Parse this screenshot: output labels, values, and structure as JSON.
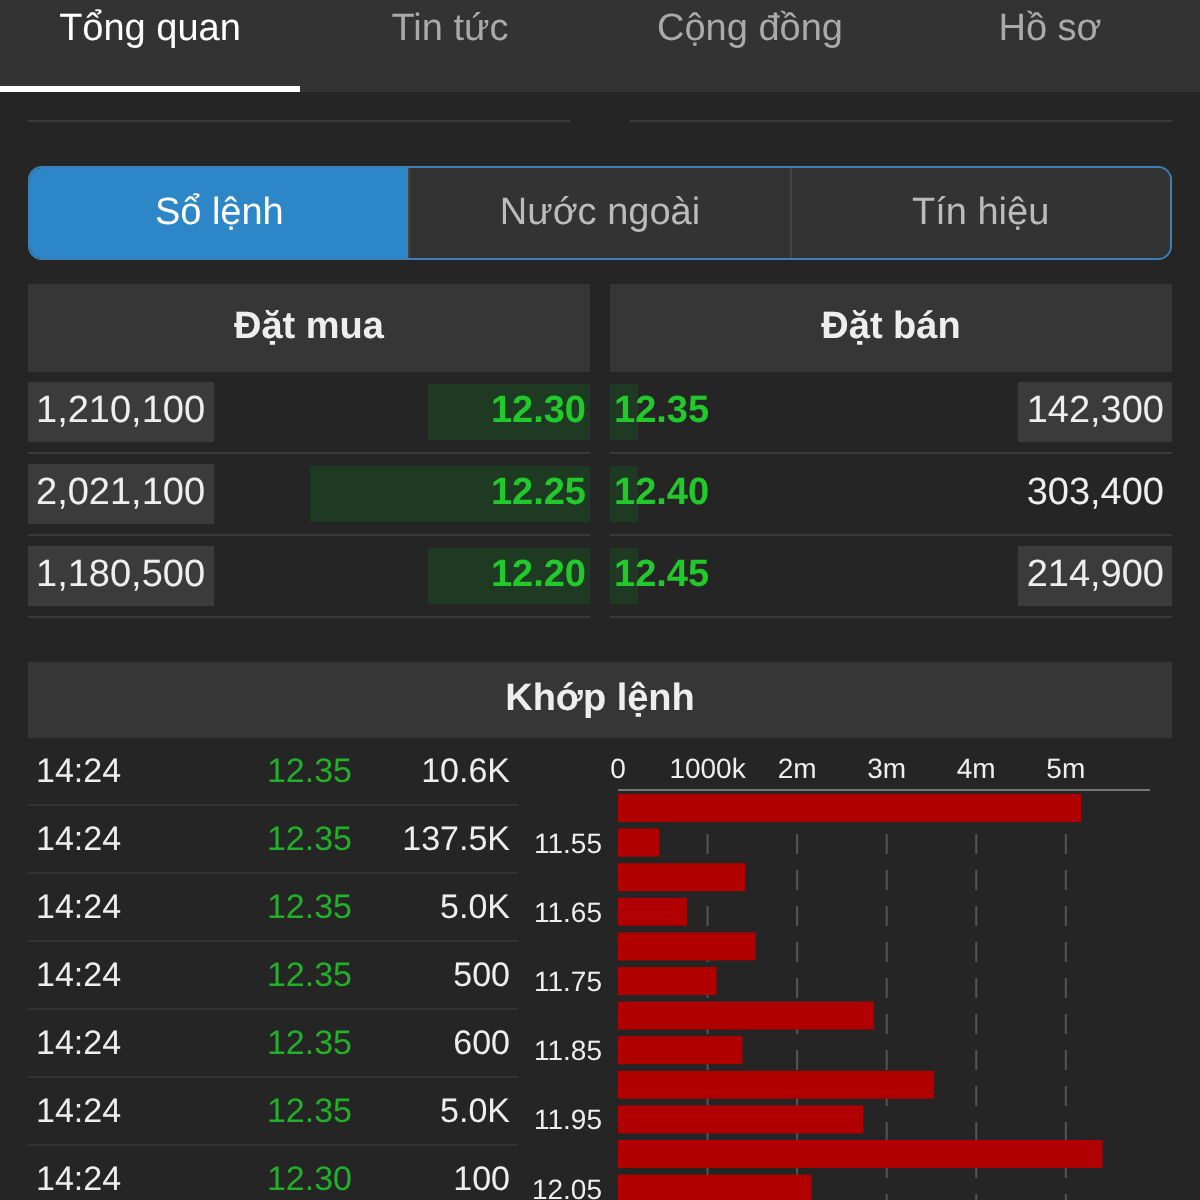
{
  "tabs": [
    {
      "label": "Tổng quan",
      "selected": true
    },
    {
      "label": "Tin tức",
      "selected": false
    },
    {
      "label": "Cộng đồng",
      "selected": false
    },
    {
      "label": "Hồ sơ",
      "selected": false
    }
  ],
  "segments": [
    {
      "label": "Sổ lệnh",
      "selected": true
    },
    {
      "label": "Nước ngoài",
      "selected": false
    },
    {
      "label": "Tín hiệu",
      "selected": false
    }
  ],
  "order_book": {
    "buy_title": "Đặt mua",
    "sell_title": "Đặt bán",
    "rows": [
      {
        "buy_volume": "1,210,100",
        "buy_price": "12.30",
        "buy_bar": {
          "level": 0.29
        },
        "sell_price": "12.35",
        "sell_bar": {
          "level": 0.05
        },
        "sell_volume": "142,300",
        "sell_boxed": true
      },
      {
        "buy_volume": "2,021,100",
        "buy_price": "12.25",
        "buy_bar": {
          "level": 0.5
        },
        "sell_price": "12.40",
        "sell_bar": {
          "level": 0.05
        },
        "sell_volume": "303,400",
        "sell_boxed": false
      },
      {
        "buy_volume": "1,180,500",
        "buy_price": "12.20",
        "buy_bar": {
          "level": 0.29
        },
        "sell_price": "12.45",
        "sell_bar": {
          "level": 0.05
        },
        "sell_volume": "214,900",
        "sell_boxed": true
      }
    ]
  },
  "matched": {
    "title": "Khớp lệnh",
    "trades": [
      {
        "time": "14:24",
        "price": "12.35",
        "volume": "10.6K"
      },
      {
        "time": "14:24",
        "price": "12.35",
        "volume": "137.5K"
      },
      {
        "time": "14:24",
        "price": "12.35",
        "volume": "5.0K"
      },
      {
        "time": "14:24",
        "price": "12.35",
        "volume": "500"
      },
      {
        "time": "14:24",
        "price": "12.35",
        "volume": "600"
      },
      {
        "time": "14:24",
        "price": "12.35",
        "volume": "5.0K"
      },
      {
        "time": "14:24",
        "price": "12.30",
        "volume": "100"
      }
    ],
    "chart_data": {
      "type": "bar",
      "orientation": "horizontal",
      "grid": true,
      "categories": [
        null,
        "11.55",
        null,
        "11.65",
        null,
        "11.75",
        null,
        "11.85",
        null,
        "11.95",
        null,
        "12.05"
      ],
      "series": [
        {
          "color": "#b00000",
          "values": [
            5170000,
            460000,
            1420000,
            770000,
            1540000,
            1100000,
            2860000,
            1390000,
            3530000,
            2740000,
            5410000,
            2160000
          ]
        }
      ],
      "xlim": [
        0,
        5940000
      ],
      "xticks": [
        0,
        {
          "value": 1000000,
          "label": "1000k"
        },
        {
          "value": 2000000,
          "label": "2m"
        },
        {
          "value": 3000000,
          "label": "3m"
        },
        {
          "value": 4000000,
          "label": "4m"
        },
        {
          "value": 5000000,
          "label": "5m"
        }
      ]
    }
  }
}
